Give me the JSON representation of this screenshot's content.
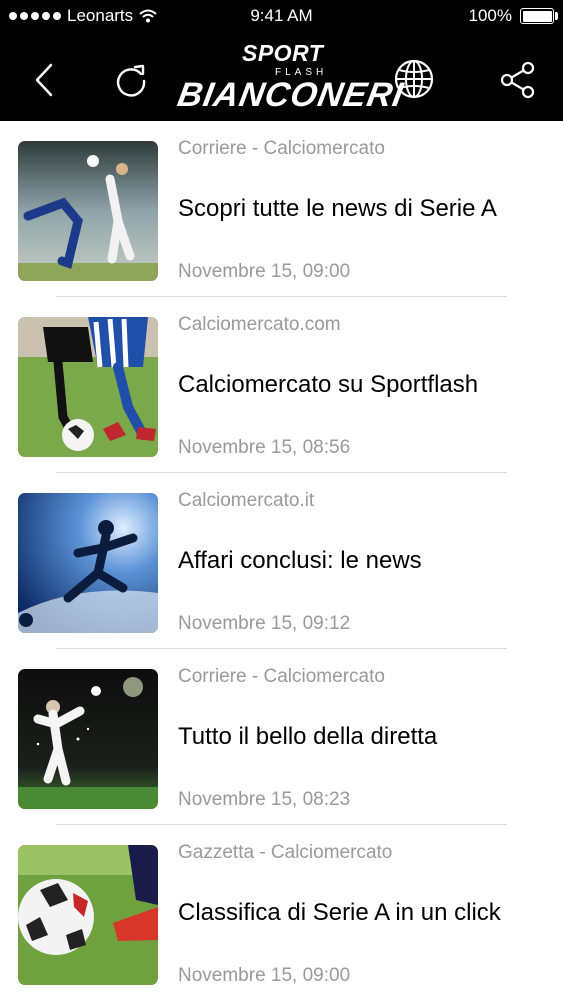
{
  "status_bar": {
    "carrier": "Leonarts",
    "time": "9:41 AM",
    "battery": "100%"
  },
  "header": {
    "logo_sport": "SPORT",
    "logo_flash": "FLASH",
    "logo_brand": "BIANCONERI",
    "icons": [
      "back-icon",
      "refresh-icon",
      "globe-icon",
      "share-icon"
    ]
  },
  "articles": [
    {
      "source": "Corriere - Calciomercato",
      "title": "Scopri tutte le news di Serie A",
      "time": "Novembre 15, 09:00"
    },
    {
      "source": "Calciomercato.com",
      "title": "Calciomercato su Sportflash",
      "time": "Novembre 15, 08:56"
    },
    {
      "source": "Calciomercato.it",
      "title": "Affari conclusi: le news",
      "time": "Novembre 15, 09:12"
    },
    {
      "source": "Corriere - Calciomercato",
      "title": "Tutto il bello della diretta",
      "time": "Novembre 15, 08:23"
    },
    {
      "source": "Gazzetta - Calciomercato",
      "title": "Classifica di Serie A in un click",
      "time": "Novembre 15, 09:00"
    }
  ]
}
